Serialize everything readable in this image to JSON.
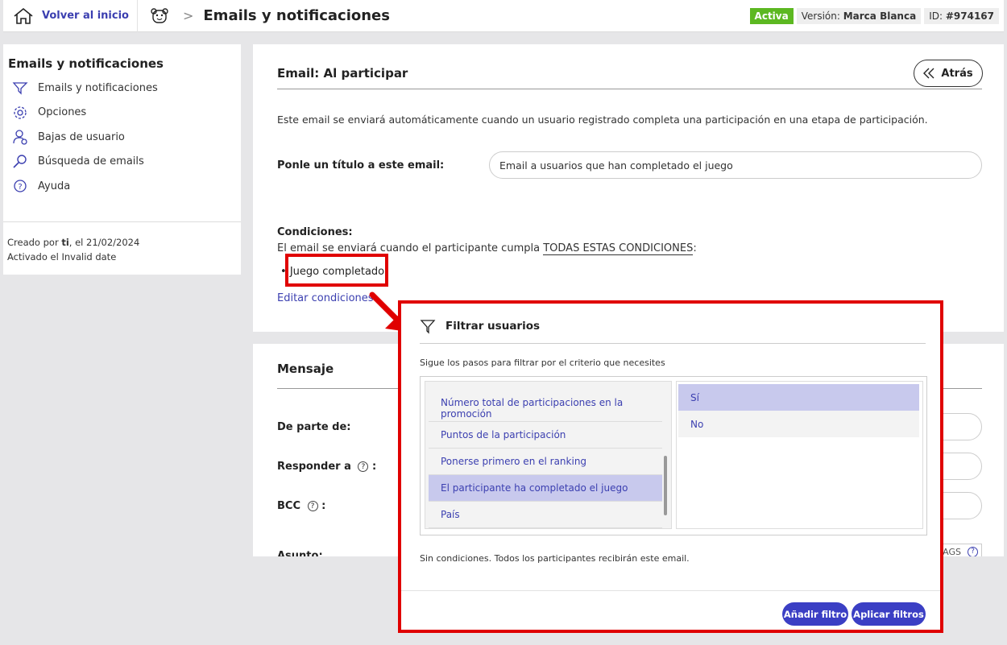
{
  "topbar": {
    "home_label": "Volver al inicio",
    "separator": ">",
    "page_title": "Emails y notificaciones",
    "status_badge": "Activa",
    "version_label": "Versión:",
    "version_value": "Marca Blanca",
    "id_label": "ID:",
    "id_value": "#974167",
    "status_color": "#5cb821"
  },
  "sidebar": {
    "title": "Emails y notificaciones",
    "items": [
      {
        "label": "Emails y notificaciones",
        "icon": "send-icon"
      },
      {
        "label": "Opciones",
        "icon": "gear-icon"
      },
      {
        "label": "Bajas de usuario",
        "icon": "user-remove-icon"
      },
      {
        "label": "Búsqueda de emails",
        "icon": "search-icon"
      },
      {
        "label": "Ayuda",
        "icon": "help-icon"
      }
    ],
    "created_prefix": "Creado por",
    "created_by": "ti",
    "created_suffix": ", el 21/02/2024",
    "activated": "Activado el Invalid date"
  },
  "main": {
    "title": "Email: Al participar",
    "back_label": "Atrás",
    "description": "Este email se enviará automáticamente cuando un usuario registrado completa una participación en una etapa de participación.",
    "title_field_label": "Ponle un título a este email:",
    "title_field_value": "Email a usuarios que han completado el juego",
    "conditions_title": "Condiciones:",
    "conditions_text_prefix": "El email se enviará cuando el participante cumpla",
    "conditions_text_emph": "TODAS ESTAS CONDICIONES",
    "conditions_text_suffix": ":",
    "condition_item": "Juego completado",
    "edit_conditions": "Editar condiciones"
  },
  "message": {
    "title": "Mensaje",
    "from_label": "De parte de:",
    "reply_label": "Responder a",
    "bcc_label": "BCC",
    "subject_label": "Asunto:",
    "help_mark": "?",
    "colon": ":",
    "tags_fragment": "AGS"
  },
  "modal": {
    "title": "Filtrar usuarios",
    "subtitle": "Sigue los pasos para filtrar por el criterio que necesites",
    "options": [
      {
        "label": "Número total de participaciones en la promoción",
        "selected": false
      },
      {
        "label": "Puntos de la participación",
        "selected": false
      },
      {
        "label": "Ponerse primero en el ranking",
        "selected": false
      },
      {
        "label": "El participante ha completado el juego",
        "selected": true
      },
      {
        "label": "País",
        "selected": false
      }
    ],
    "values": [
      {
        "label": "Sí",
        "selected": true
      },
      {
        "label": "No",
        "selected": false
      }
    ],
    "no_conditions": "Sin condiciones. Todos los participantes recibirán este email.",
    "add_filter": "Añadir filtro",
    "apply_filters": "Aplicar filtros",
    "accent_color": "#3b3fc4",
    "highlight_color": "#e00000"
  }
}
